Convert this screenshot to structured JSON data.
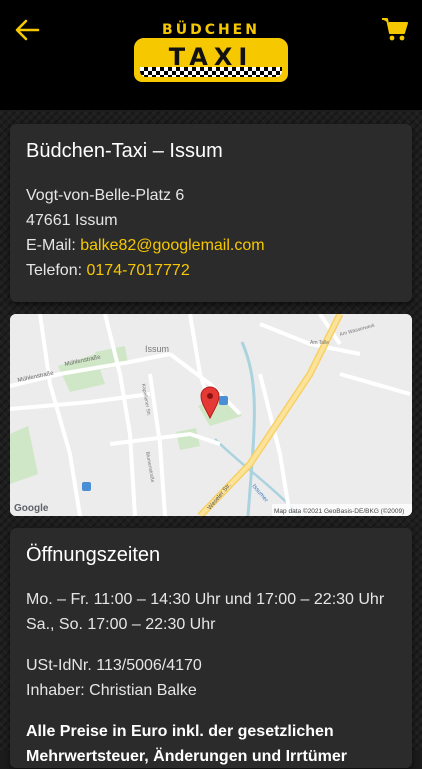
{
  "header": {
    "logo_top": "BÜDCHEN",
    "logo_word": "TAXI",
    "back_icon": "arrow-left-icon",
    "cart_icon": "shopping-cart-icon",
    "accent": "#f6c800"
  },
  "contact": {
    "title": "Büdchen-Taxi – Issum",
    "street": "Vogt-von-Belle-Platz 6",
    "city": "47661 Issum",
    "email_label": "E-Mail:",
    "email": "balke82@googlemail.com",
    "phone_label": "Telefon:",
    "phone": "0174-7017772"
  },
  "map": {
    "town_label": "Issum",
    "streets": [
      "Mühlenstraße",
      "Mühlenstraße",
      "Weseler Str.",
      "Issumer",
      "Kapellener Str.",
      "Blumenstraße",
      "Am Wasserwerk",
      "Am Talle"
    ],
    "attribution": "Map data ©2021 GeoBasis-DE/BKG (©2009)",
    "google": "Google"
  },
  "hours": {
    "title": "Öffnungszeiten",
    "weekdays": "Mo. – Fr. 11:00 – 14:30 Uhr und 17:00 – 22:30 Uhr",
    "weekend": "Sa., So. 17:00 – 22:30 Uhr",
    "vat": "USt-IdNr. 113/5006/4170",
    "owner": "Inhaber: Christian Balke",
    "notice_1": "Alle Preise in Euro inkl. der gesetzlichen",
    "notice_2": "Mehrwertsteuer, Änderungen und Irrtümer"
  }
}
